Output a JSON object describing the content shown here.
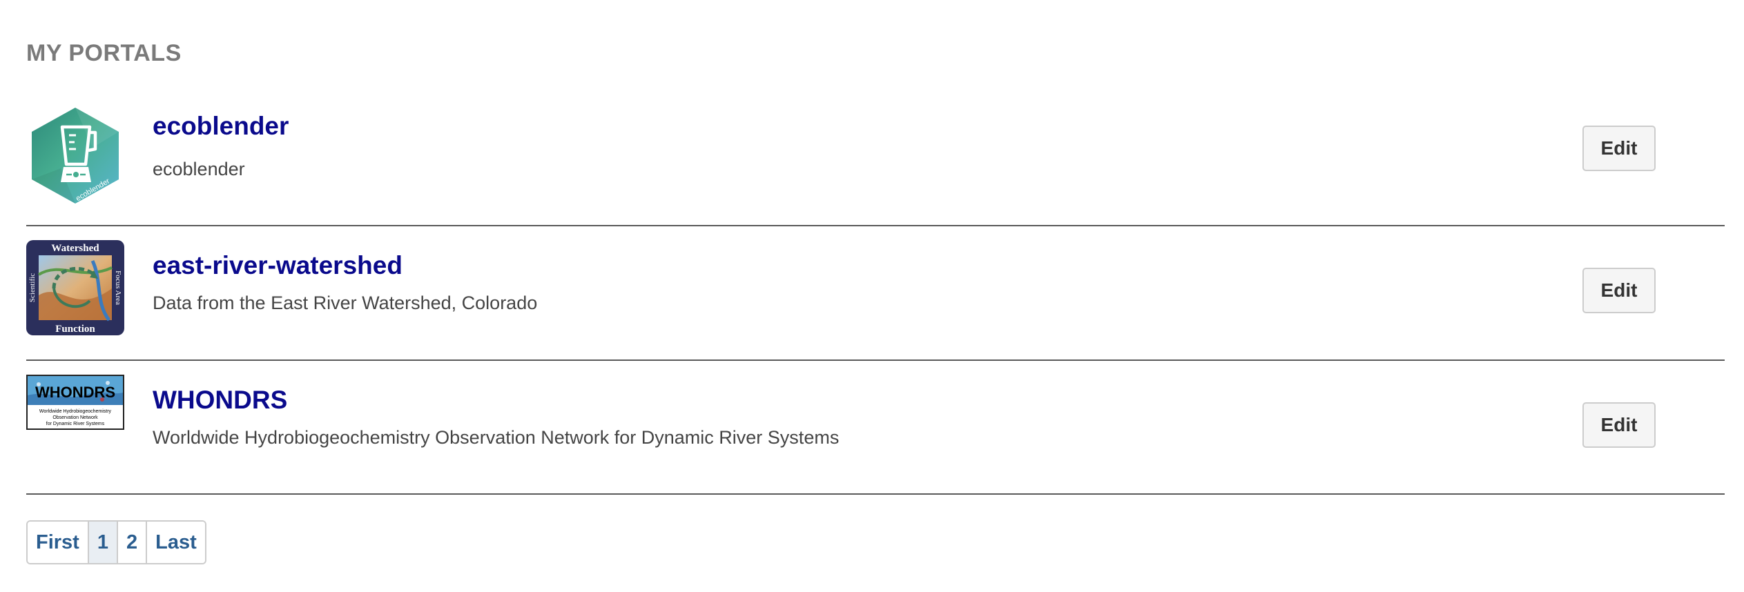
{
  "section_title": "MY PORTALS",
  "portals": [
    {
      "name": "ecoblender",
      "description": "ecoblender",
      "edit_label": "Edit",
      "logo": {
        "icon": "blender-hexagon-logo",
        "caption": "ecoblender",
        "colors": [
          "#2f8f7f",
          "#3fa98f",
          "#58b8c8"
        ]
      }
    },
    {
      "name": "east-river-watershed",
      "description": "Data from the East River Watershed, Colorado",
      "edit_label": "Edit",
      "logo": {
        "icon": "watershed-logo",
        "top": "Watershed",
        "bottom": "Function",
        "left": "Scientific",
        "right": "Focus Area",
        "colors": [
          "#2b2f5c",
          "#c98a45",
          "#3b7bbf"
        ]
      }
    },
    {
      "name": "WHONDRS",
      "description": "Worldwide Hydrobiogeochemistry Observation Network for Dynamic River Systems",
      "edit_label": "Edit",
      "logo": {
        "icon": "whondrs-logo",
        "title": "WHONDRS",
        "line1": "Worldwide Hydrobiogeochemistry",
        "line2": "Observation Network",
        "line3": "for Dynamic River Systems",
        "colors": [
          "#5aa6d6",
          "#000000"
        ]
      }
    }
  ],
  "pagination": {
    "first": "First",
    "pages": [
      "1",
      "2"
    ],
    "current": "1",
    "last": "Last"
  },
  "colors": {
    "link": "#0a0a8c",
    "pagination_link": "#2a5d8f",
    "title_gray": "#7a7a7a"
  }
}
